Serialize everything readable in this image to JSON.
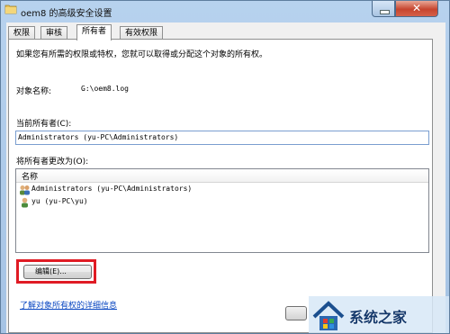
{
  "window": {
    "title": "oem8 的高级安全设置"
  },
  "tabs": [
    {
      "label": "权限"
    },
    {
      "label": "审核"
    },
    {
      "label": "所有者"
    },
    {
      "label": "有效权限"
    }
  ],
  "owner_page": {
    "description": "如果您有所需的权限或特权，您就可以取得或分配这个对象的所有权。",
    "object_name_label": "对象名称:",
    "object_name_value": "G:\\oem8.log",
    "current_owner_label": "当前所有者(C):",
    "current_owner_value": "Administrators (yu-PC\\Administrators)",
    "change_owner_label": "将所有者更改为(O):",
    "list": {
      "column": "名称",
      "items": [
        {
          "name": "Administrators (yu-PC\\Administrators)",
          "icon": "user-group-icon"
        },
        {
          "name": "yu (yu-PC\\yu)",
          "icon": "user-icon"
        }
      ]
    },
    "edit_button": "编辑(E)...",
    "learn_more_link": "了解对象所有权的详细信息"
  },
  "watermark": {
    "text": "系统之家"
  }
}
